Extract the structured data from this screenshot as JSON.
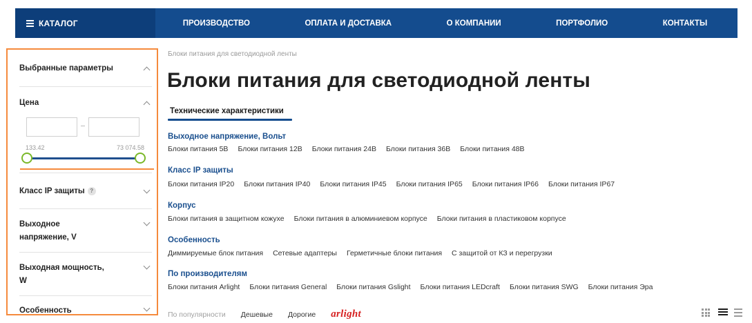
{
  "nav": {
    "catalog_label": "КАТАЛОГ",
    "items": [
      "ПРОИЗВОДСТВО",
      "ОПЛАТА И ДОСТАВКА",
      "О КОМПАНИИ",
      "ПОРТФОЛИО",
      "КОНТАКТЫ"
    ]
  },
  "sidebar": {
    "selected_params": "Выбранные параметры",
    "price": {
      "title": "Цена",
      "min_value": "",
      "max_value": "",
      "range_min_label": "133.42",
      "range_max_label": "73 074.58"
    },
    "ip_class": "Класс IP защиты",
    "help_mark": "?",
    "voltage": "Выходное напряжение, V",
    "power": "Выходная мощность, W",
    "feature": "Особенность"
  },
  "breadcrumb": "Блоки питания для светодиодной ленты",
  "page_title": "Блоки питания для светодиодной ленты",
  "tab_label": "Технические характеристики",
  "groups": [
    {
      "title": "Выходное напряжение, Вольт",
      "links": [
        "Блоки питания 5В",
        "Блоки питания 12В",
        "Блоки питания 24В",
        "Блоки питания 36В",
        "Блоки питания 48В"
      ]
    },
    {
      "title": "Класс IP защиты",
      "links": [
        "Блоки питания IP20",
        "Блоки питания IP40",
        "Блоки питания IP45",
        "Блоки питания IP65",
        "Блоки питания IP66",
        "Блоки питания IP67"
      ]
    },
    {
      "title": "Корпус",
      "links": [
        "Блоки питания в защитном кожухе",
        "Блоки питания в алюминиевом корпусе",
        "Блоки питания в пластиковом корпусе"
      ]
    },
    {
      "title": "Особенность",
      "links": [
        "Диммируемые блок питания",
        "Сетевые адаптеры",
        "Герметичные блоки питания",
        "С защитой от КЗ и перегрузки"
      ]
    },
    {
      "title": "По производителям",
      "links": [
        "Блоки питания Arlight",
        "Блоки питания General",
        "Блоки питания Gslight",
        "Блоки питания LEDcraft",
        "Блоки питания SWG",
        "Блоки питания Эра"
      ]
    }
  ],
  "sort": {
    "popularity": "По популярности",
    "cheap": "Дешевые",
    "expensive": "Дорогие",
    "brand": "arlight"
  },
  "colors": {
    "nav_bg": "#144c8e",
    "accent_orange": "#f58a3c",
    "link_blue": "#1a4f8e",
    "handle_green": "#7ab828",
    "brand_red": "#d62020"
  }
}
